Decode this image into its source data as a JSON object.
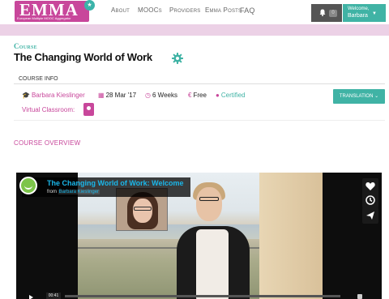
{
  "app": {
    "logo_text": "EMMA",
    "logo_tagline": "European Multiple MOOC Aggregator"
  },
  "nav": {
    "about": "About",
    "moocs": "MOOCs",
    "providers": "Providers",
    "emma_posts": "Emma Posts",
    "faq": "FAQ"
  },
  "user": {
    "notifications_count": "0",
    "welcome": "Welcome,",
    "name": "Barbara"
  },
  "course": {
    "label": "Course",
    "title": "The Changing World of Work",
    "info_tab": "COURSE INFO",
    "author": "Barbara Kieslinger",
    "date": "28 Mar '17",
    "duration": "6 Weeks",
    "price": "Free",
    "certified": "Certified",
    "translation_button": "TRANSLATION",
    "virtual_classroom": "Virtual Classroom:",
    "overview_heading": "COURSE OVERVIEW"
  },
  "video": {
    "title": "The Changing World of Work: Welcome",
    "from_label": "from",
    "from_name": "Barbara Kieslinger",
    "time": "00:41"
  },
  "colors": {
    "brand_pink": "#c8479b",
    "brand_teal": "#40b3a5",
    "band_pink": "#ecd1e6",
    "vimeo_blue": "#1ab7ea"
  },
  "icons": [
    "bell-icon",
    "gear-icon",
    "graduation-cap-icon",
    "calendar-icon",
    "clock-icon",
    "euro-icon",
    "certified-icon",
    "classroom-icon",
    "heart-icon",
    "clock-later-icon",
    "send-icon",
    "play-icon",
    "volume-icon"
  ]
}
